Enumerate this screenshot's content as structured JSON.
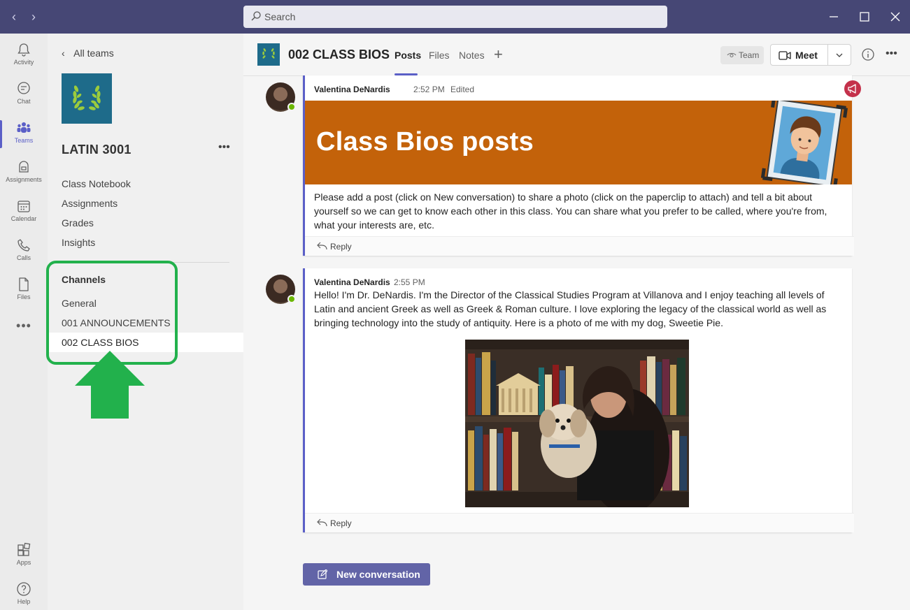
{
  "search": {
    "placeholder": "Search"
  },
  "rail": {
    "items": [
      {
        "label": "Activity",
        "icon": "bell-icon"
      },
      {
        "label": "Chat",
        "icon": "chat-icon"
      },
      {
        "label": "Teams",
        "icon": "teams-icon"
      },
      {
        "label": "Assignments",
        "icon": "assignments-icon"
      },
      {
        "label": "Calendar",
        "icon": "calendar-icon"
      },
      {
        "label": "Calls",
        "icon": "phone-icon"
      },
      {
        "label": "Files",
        "icon": "file-icon"
      },
      {
        "label": "Apps",
        "icon": "apps-icon"
      },
      {
        "label": "Help",
        "icon": "help-icon"
      }
    ],
    "more": "•••"
  },
  "team": {
    "back_label": "All teams",
    "name": "LATIN 3001",
    "more": "•••",
    "tabs": [
      "Class Notebook",
      "Assignments",
      "Grades",
      "Insights"
    ],
    "channels_heading": "Channels",
    "channels": [
      "General",
      "001 ANNOUNCEMENTS",
      "002 CLASS BIOS"
    ]
  },
  "channel": {
    "title": "002 CLASS BIOS",
    "tabs": [
      "Posts",
      "Files",
      "Notes"
    ],
    "team_button": "Team",
    "meet_button": "Meet",
    "more": "•••"
  },
  "posts": [
    {
      "author": "Valentina DeNardis",
      "time": "2:52 PM",
      "edited": "Edited",
      "banner_title": "Class Bios posts",
      "body": "Please add a post (click on New conversation) to share a photo (click on the paperclip to attach) and tell a bit about yourself so we can get to know each other in this class.  You can share what you prefer to be called, where you're from, what your interests are, etc.",
      "reply": "Reply"
    },
    {
      "author": "Valentina DeNardis",
      "time": "2:55 PM",
      "body": "Hello!  I'm Dr. DeNardis.  I'm the Director of the Classical Studies Program at Villanova and I enjoy teaching all levels of Latin and ancient Greek as well as Greek & Roman culture.  I love exploring the legacy of the classical world as well as bringing technology into the study of antiquity.  Here is a photo of me with my dog, Sweetie Pie.",
      "reply": "Reply"
    }
  ],
  "new_conversation": "New conversation",
  "colors": {
    "titlebar": "#464775",
    "accent": "#5b5fc7",
    "banner": "#c3620a",
    "highlight": "#22b14c"
  }
}
